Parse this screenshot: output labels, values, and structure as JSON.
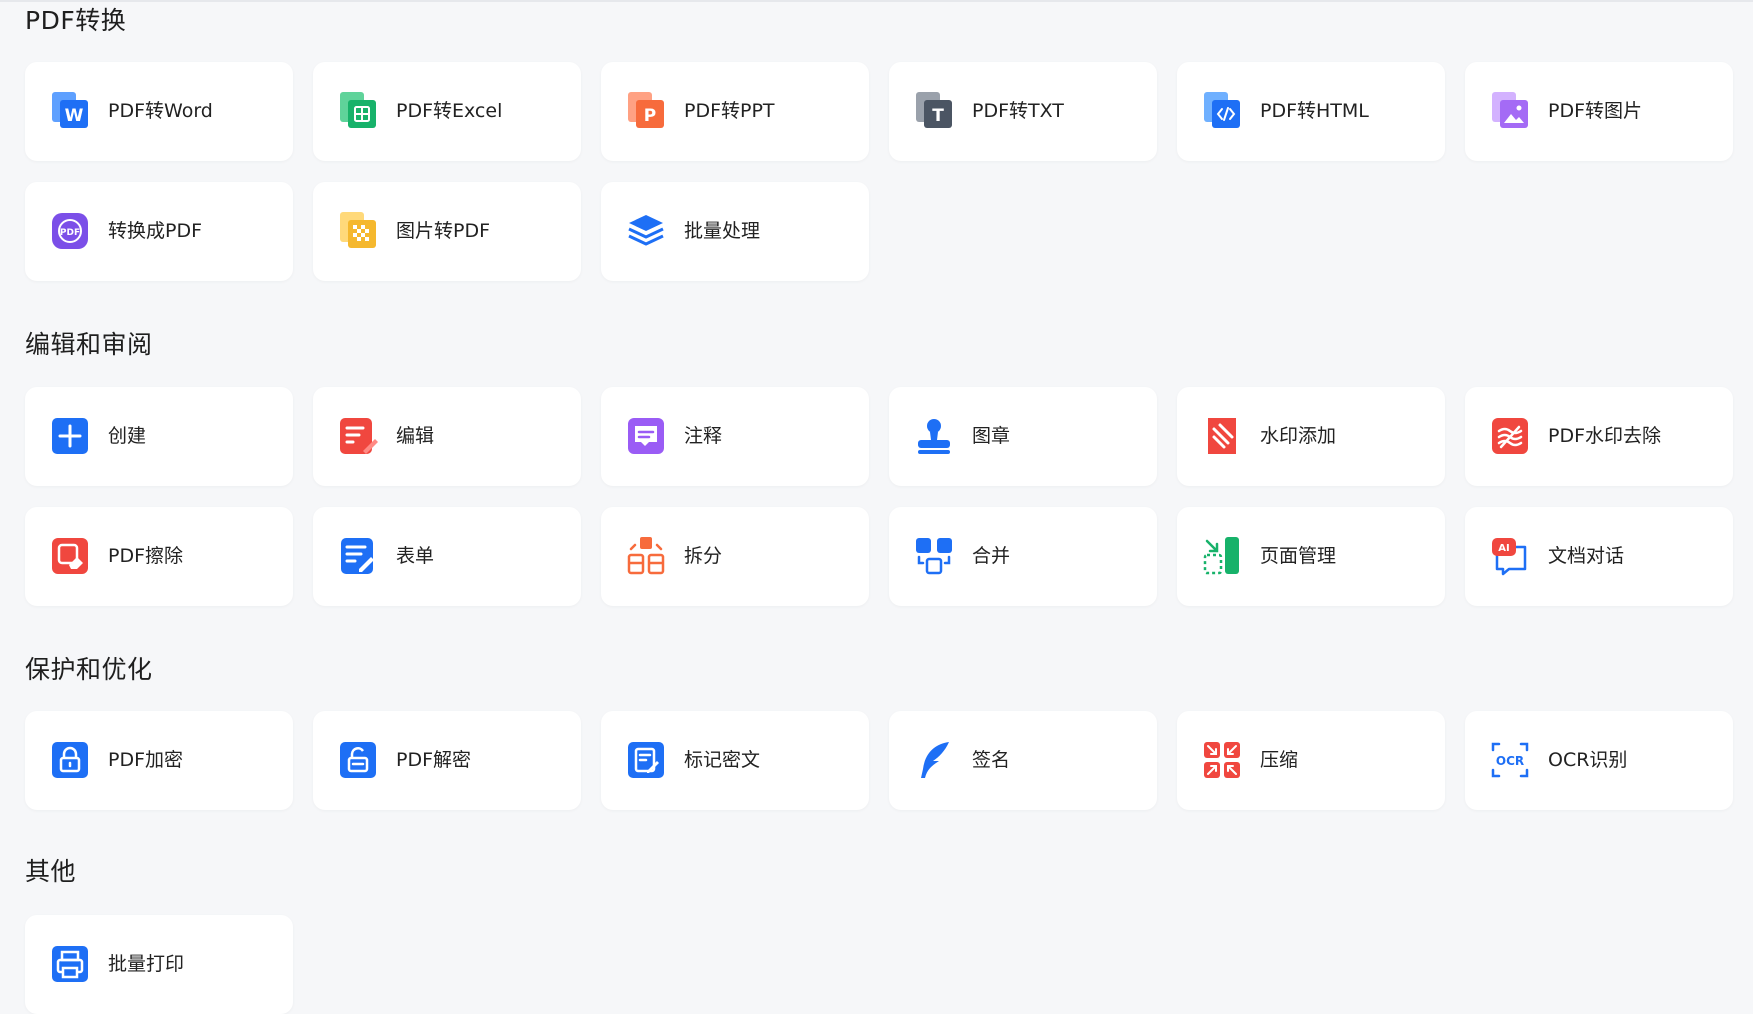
{
  "sections": {
    "convert": {
      "title": "PDF转换",
      "items": [
        {
          "label": "PDF转Word",
          "icon": "word-doc-icon"
        },
        {
          "label": "PDF转Excel",
          "icon": "excel-doc-icon"
        },
        {
          "label": "PDF转PPT",
          "icon": "ppt-doc-icon"
        },
        {
          "label": "PDF转TXT",
          "icon": "txt-doc-icon"
        },
        {
          "label": "PDF转HTML",
          "icon": "html-doc-icon"
        },
        {
          "label": "PDF转图片",
          "icon": "image-doc-icon"
        },
        {
          "label": "转换成PDF",
          "icon": "convert-to-pdf-icon"
        },
        {
          "label": "图片转PDF",
          "icon": "image-to-pdf-icon"
        },
        {
          "label": "批量处理",
          "icon": "layers-stack-icon"
        }
      ]
    },
    "edit": {
      "title": "编辑和审阅",
      "items": [
        {
          "label": "创建",
          "icon": "plus-create-icon"
        },
        {
          "label": "编辑",
          "icon": "edit-doc-icon"
        },
        {
          "label": "注释",
          "icon": "comment-icon"
        },
        {
          "label": "图章",
          "icon": "stamp-icon"
        },
        {
          "label": "水印添加",
          "icon": "watermark-add-icon"
        },
        {
          "label": "PDF水印去除",
          "icon": "watermark-remove-icon"
        },
        {
          "label": "PDF擦除",
          "icon": "eraser-icon"
        },
        {
          "label": "表单",
          "icon": "form-icon"
        },
        {
          "label": "拆分",
          "icon": "split-icon"
        },
        {
          "label": "合并",
          "icon": "merge-icon"
        },
        {
          "label": "页面管理",
          "icon": "page-manage-icon"
        },
        {
          "label": "文档对话",
          "icon": "ai-chat-icon"
        }
      ]
    },
    "protect": {
      "title": "保护和优化",
      "items": [
        {
          "label": "PDF加密",
          "icon": "lock-icon"
        },
        {
          "label": "PDF解密",
          "icon": "unlock-icon"
        },
        {
          "label": "标记密文",
          "icon": "redact-icon"
        },
        {
          "label": "签名",
          "icon": "feather-sign-icon"
        },
        {
          "label": "压缩",
          "icon": "compress-icon"
        },
        {
          "label": "OCR识别",
          "icon": "ocr-icon"
        }
      ]
    },
    "other": {
      "title": "其他",
      "items": [
        {
          "label": "批量打印",
          "icon": "printer-icon"
        }
      ]
    }
  },
  "colors": {
    "blue": "#1e6ff5",
    "green": "#17b26a",
    "orange": "#f76b3c",
    "gray": "#4b5563",
    "purple": "#9a5cf5",
    "red": "#f0473f"
  }
}
